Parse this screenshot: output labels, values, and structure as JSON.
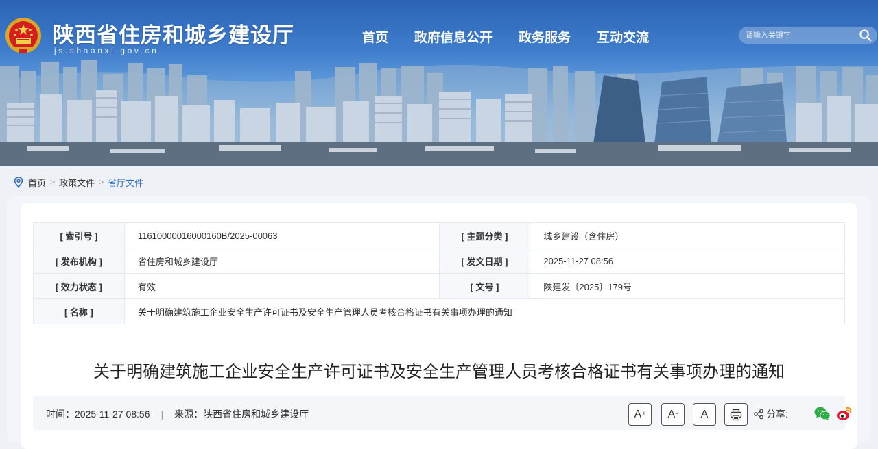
{
  "header": {
    "site_title": "陕西省住房和城乡建设厅",
    "site_domain": "js.shaanxi.gov.cn",
    "nav": [
      {
        "label": "首页"
      },
      {
        "label": "政府信息公开"
      },
      {
        "label": "政务服务"
      },
      {
        "label": "互动交流"
      }
    ],
    "search": {
      "placeholder": "请输入关键字"
    }
  },
  "breadcrumb": {
    "items": [
      "首页",
      "政策文件",
      "省厅文件"
    ],
    "separator": ">"
  },
  "meta": {
    "index_no_label": "[ 索引号 ]",
    "index_no": "11610000016000160B/2025-00063",
    "topic_label": "[ 主题分类 ]",
    "topic": "城乡建设（含住房）",
    "publisher_label": "[ 发布机构 ]",
    "publisher": "省住房和城乡建设厅",
    "date_label": "[ 发文日期 ]",
    "date": "2025-11-27 08:56",
    "status_label": "[ 效力状态 ]",
    "status": "有效",
    "doc_no_label": "[ 文号 ]",
    "doc_no": "陕建发〔2025〕179号",
    "name_label": "[ 名称 ]",
    "name": "关于明确建筑施工企业安全生产许可证书及安全生产管理人员考核合格证书有关事项办理的通知"
  },
  "article": {
    "title": "关于明确建筑施工企业安全生产许可证书及安全生产管理人员考核合格证书有关事项办理的通知",
    "time_label": "时间：",
    "time": "2025-11-27 08:56",
    "divider": "|",
    "source_label": "来源：",
    "source": "陕西省住房和城乡建设厅",
    "font_large": "A",
    "font_large_mark": "+",
    "font_small": "A",
    "font_small_mark": "-",
    "font_default": "A",
    "share_label": "分享:"
  },
  "colors": {
    "accent": "#2b6bc7",
    "valid_status": "#1a8a2a",
    "wechat": "#2aae44",
    "weibo": "#e6162d"
  },
  "icons": [
    "national-emblem-icon",
    "search-icon",
    "location-pin-icon",
    "print-icon",
    "share-icon",
    "wechat-icon",
    "weibo-icon"
  ]
}
